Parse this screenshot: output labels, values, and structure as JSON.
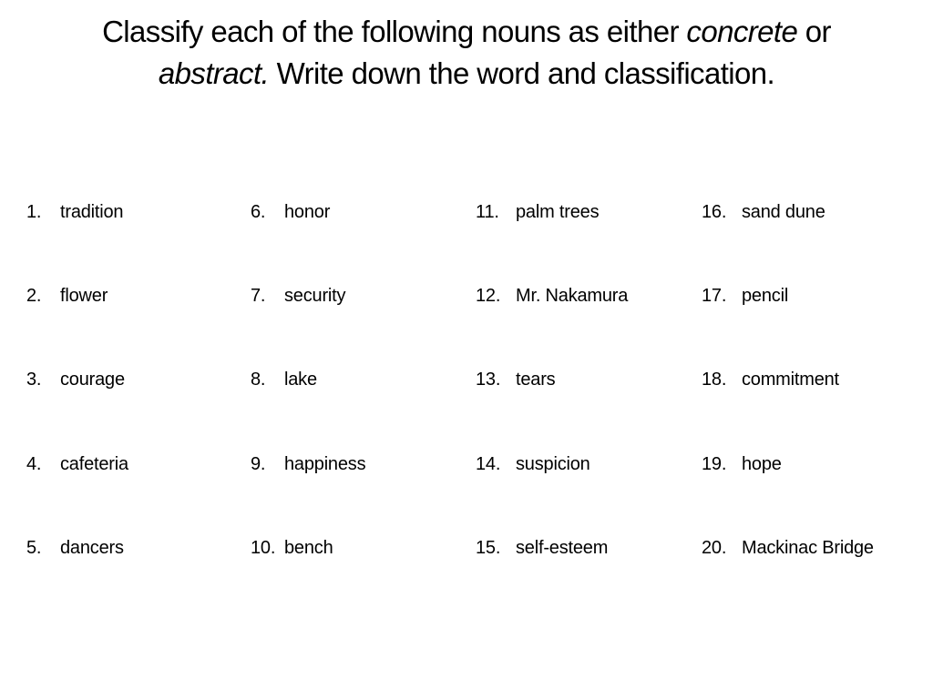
{
  "title": {
    "part1": "Classify each of the following nouns as either ",
    "concrete": "concrete",
    "part2": " or ",
    "abstract": "abstract.",
    "part3": "  Write down the word and classification."
  },
  "columns": [
    {
      "items": [
        {
          "number": "1.",
          "word": "tradition"
        },
        {
          "number": "2.",
          "word": "flower"
        },
        {
          "number": "3.",
          "word": "courage"
        },
        {
          "number": "4.",
          "word": "cafeteria"
        },
        {
          "number": "5.",
          "word": "dancers"
        }
      ]
    },
    {
      "items": [
        {
          "number": "6.",
          "word": "honor"
        },
        {
          "number": "7.",
          "word": "security"
        },
        {
          "number": "8.",
          "word": "lake"
        },
        {
          "number": "9.",
          "word": "happiness"
        },
        {
          "number": "10.",
          "word": "bench"
        }
      ]
    },
    {
      "items": [
        {
          "number": "11.",
          "word": "palm trees"
        },
        {
          "number": "12.",
          "word": "Mr. Nakamura"
        },
        {
          "number": "13.",
          "word": "tears"
        },
        {
          "number": "14.",
          "word": "suspicion"
        },
        {
          "number": "15.",
          "word": "self-esteem"
        }
      ]
    },
    {
      "items": [
        {
          "number": "16.",
          "word": "sand dune"
        },
        {
          "number": "17.",
          "word": "pencil"
        },
        {
          "number": "18.",
          "word": "commitment"
        },
        {
          "number": "19.",
          "word": "hope"
        },
        {
          "number": "20.",
          "word": "Mackinac Bridge"
        }
      ]
    }
  ]
}
